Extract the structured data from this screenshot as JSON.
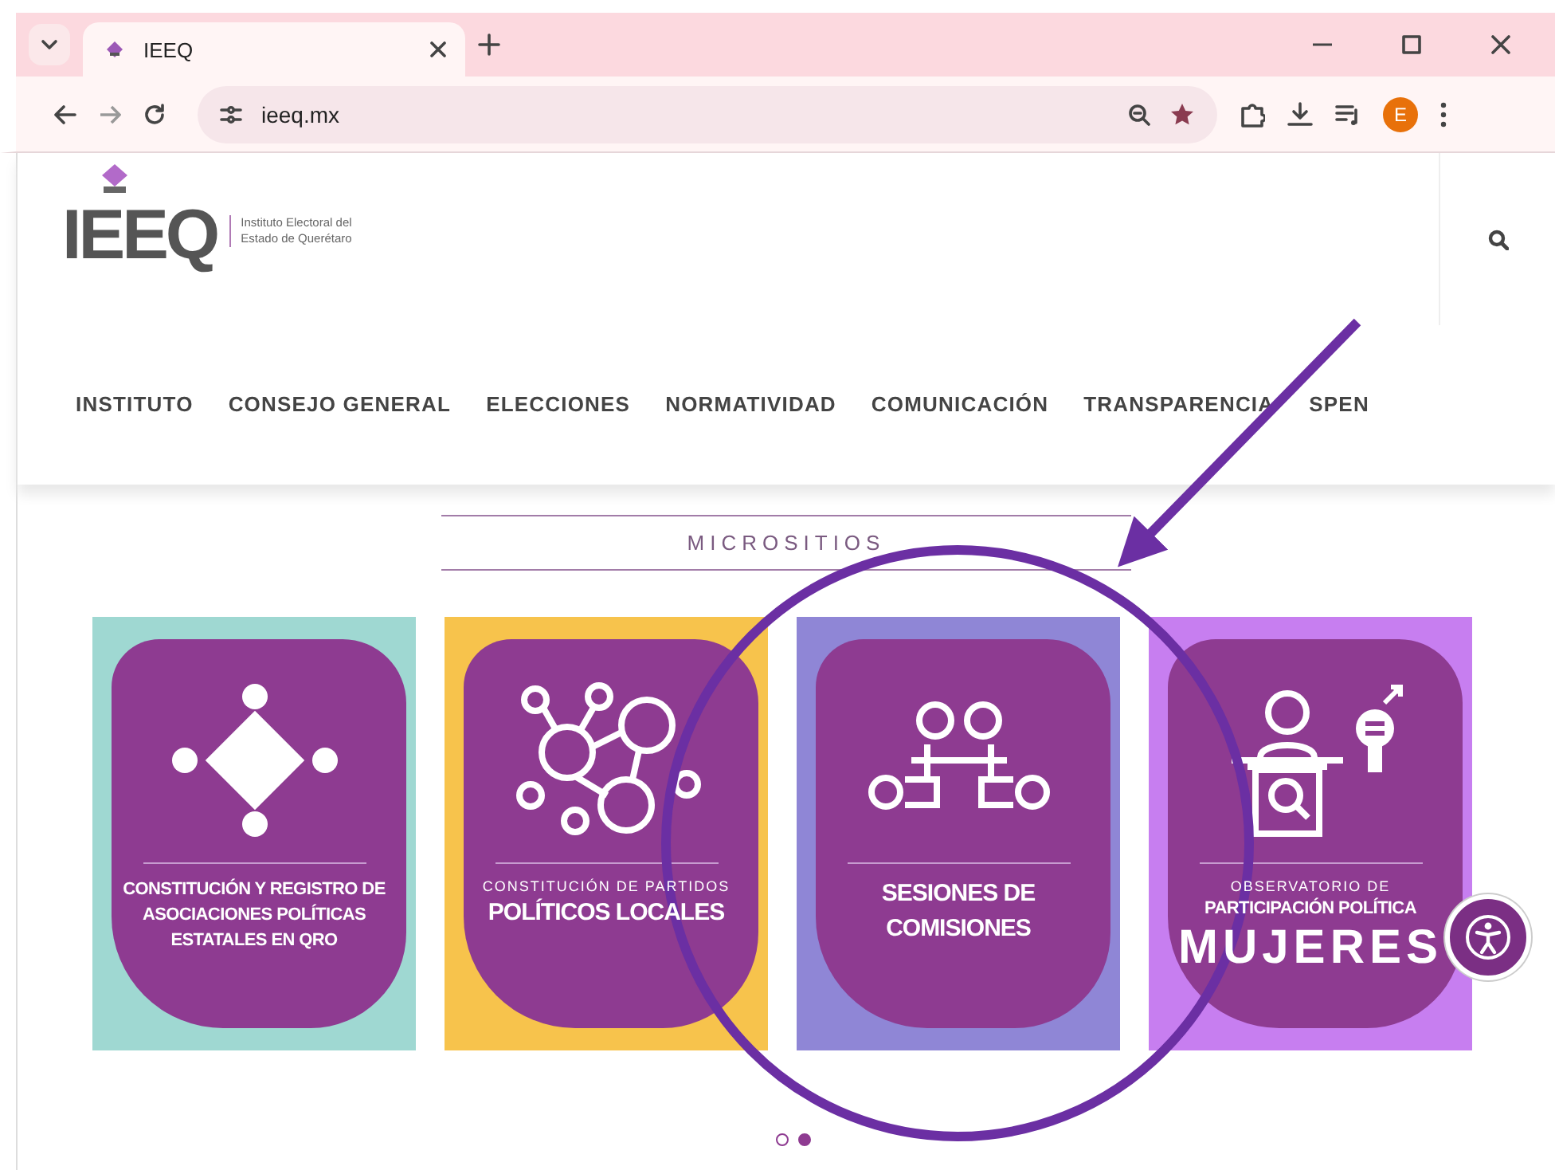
{
  "browser": {
    "tab_title": "IEEQ",
    "url": "ieeq.mx",
    "profile_initial": "E"
  },
  "header": {
    "logo_mark": "IEEQ",
    "logo_caption": [
      "Instituto Electoral del",
      "Estado de Querétaro"
    ]
  },
  "nav": [
    "INSTITUTO",
    "CONSEJO GENERAL",
    "ELECCIONES",
    "NORMATIVIDAD",
    "COMUNICACIÓN",
    "TRANSPARENCIA",
    "SPEN"
  ],
  "section_title": "MICROSITIOS",
  "cards": [
    {
      "color": "#9fd8d2",
      "lines": [
        {
          "kind": "bold",
          "text": "CONSTITUCIÓN Y REGISTRO DE"
        },
        {
          "kind": "bold",
          "text": "ASOCIACIONES POLÍTICAS"
        },
        {
          "kind": "bold",
          "text": "ESTATALES EN QRO"
        }
      ]
    },
    {
      "color": "#f7c34c",
      "lines": [
        {
          "kind": "small",
          "text": "CONSTITUCIÓN DE PARTIDOS"
        },
        {
          "kind": "big",
          "text": "POLÍTICOS LOCALES"
        }
      ]
    },
    {
      "color": "#8f86d6",
      "lines": [
        {
          "kind": "big",
          "text": "SESIONES DE"
        },
        {
          "kind": "big",
          "text": "COMISIONES"
        }
      ]
    },
    {
      "color": "#c77ef0",
      "lines": [
        {
          "kind": "small",
          "text": "OBSERVATORIO DE"
        },
        {
          "kind": "bold",
          "text": "PARTICIPACIÓN POLÍTICA"
        },
        {
          "kind": "huge",
          "text": "MUJERES"
        }
      ]
    }
  ],
  "carousel_dots": [
    {
      "selected": false
    },
    {
      "selected": true
    }
  ]
}
